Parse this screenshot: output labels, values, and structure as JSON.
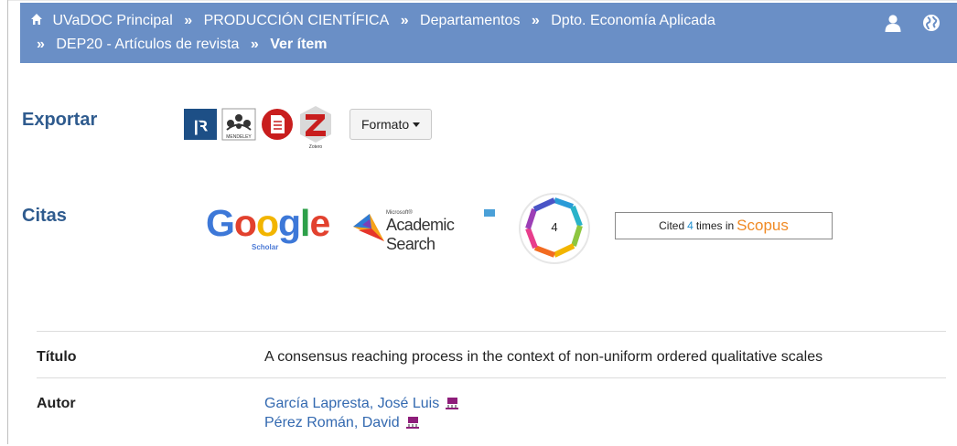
{
  "breadcrumb": {
    "items": [
      "UVaDOC Principal",
      "PRODUCCIÓN CIENTÍFICA",
      "Departamentos",
      "Dpto. Economía Aplicada",
      "DEP20 - Artículos de revista"
    ],
    "current": "Ver ítem",
    "separator": "»"
  },
  "export": {
    "label": "Exportar",
    "icons": [
      "refworks-icon",
      "mendeley-icon",
      "pdf-export-icon",
      "zotero-icon"
    ],
    "mendeley_caption": "MENDELEY",
    "zotero_caption": "Zotero",
    "format_button": "Formato"
  },
  "citations": {
    "label": "Citas",
    "google": {
      "word": "Google",
      "sub": "Scholar"
    },
    "ms_academic": {
      "top": "Microsoft®",
      "name": "Academic Search"
    },
    "altmetric_score": "4",
    "scopus": {
      "prefix": "Cited",
      "count": "4",
      "middle": "times in",
      "brand": "Scopus"
    }
  },
  "metadata": [
    {
      "key": "Título",
      "value": "A consensus reaching process in the context of non-uniform ordered qualitative scales"
    },
    {
      "key": "Autor",
      "values": [
        "García Lapresta, José Luis",
        "Pérez Román, David"
      ]
    }
  ],
  "colors": {
    "bar": "#6a8fc6",
    "label": "#2f5b8e",
    "link": "#3369b0"
  }
}
